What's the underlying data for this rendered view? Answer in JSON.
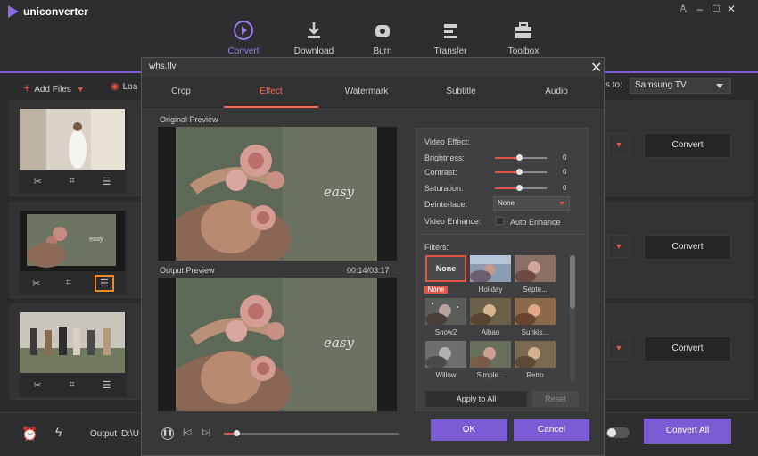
{
  "app": {
    "title": "uniconverter"
  },
  "window_controls": {
    "user": "♙",
    "minimize": "–",
    "maximize": "□",
    "close": "✕"
  },
  "nav": [
    {
      "label": "Convert",
      "icon": "convert-icon",
      "active": true
    },
    {
      "label": "Download",
      "icon": "download-icon"
    },
    {
      "label": "Burn",
      "icon": "burn-icon"
    },
    {
      "label": "Transfer",
      "icon": "transfer-icon"
    },
    {
      "label": "Toolbox",
      "icon": "toolbox-icon"
    }
  ],
  "toolbar": {
    "add_files": "Add Files",
    "load": "Loa",
    "convert_to_suffix": "s to:",
    "target_format": "Samsung TV"
  },
  "file_rows": [
    {
      "convert_label": "Convert"
    },
    {
      "convert_label": "Convert"
    },
    {
      "convert_label": "Convert"
    }
  ],
  "bottom": {
    "output_label": "Output",
    "output_path": "D:\\U",
    "convert_all": "Convert All"
  },
  "dialog": {
    "filename": "whs.flv",
    "tabs": [
      "Crop",
      "Effect",
      "Watermark",
      "Subtitle",
      "Audio"
    ],
    "active_tab": "Effect",
    "original_preview_label": "Original Preview",
    "output_preview_label": "Output Preview",
    "timestamp": "00:14/03:17",
    "watermark_text": "easy",
    "playback_progress": 0.07,
    "effects": {
      "heading": "Video Effect:",
      "brightness_label": "Brightness:",
      "brightness_value": "0",
      "contrast_label": "Contrast:",
      "contrast_value": "0",
      "saturation_label": "Saturation:",
      "saturation_value": "0",
      "deinterlace_label": "Deinterlace:",
      "deinterlace_value": "None",
      "enhance_label": "Video Enhance:",
      "auto_enhance_label": "Auto Enhance"
    },
    "filters_heading": "Filters:",
    "filters": [
      {
        "name": "None",
        "selected": true
      },
      {
        "name": "Holiday"
      },
      {
        "name": "Septe..."
      },
      {
        "name": "Snow2"
      },
      {
        "name": "Aibao"
      },
      {
        "name": "Sunkis..."
      },
      {
        "name": "Willow"
      },
      {
        "name": "Simple..."
      },
      {
        "name": "Retro"
      }
    ],
    "apply_all": "Apply to All",
    "reset": "Reset",
    "ok": "OK",
    "cancel": "Cancel"
  },
  "colors": {
    "accent": "#7a5cd4",
    "highlight": "#e05545",
    "active_nav": "#9d7af0"
  }
}
